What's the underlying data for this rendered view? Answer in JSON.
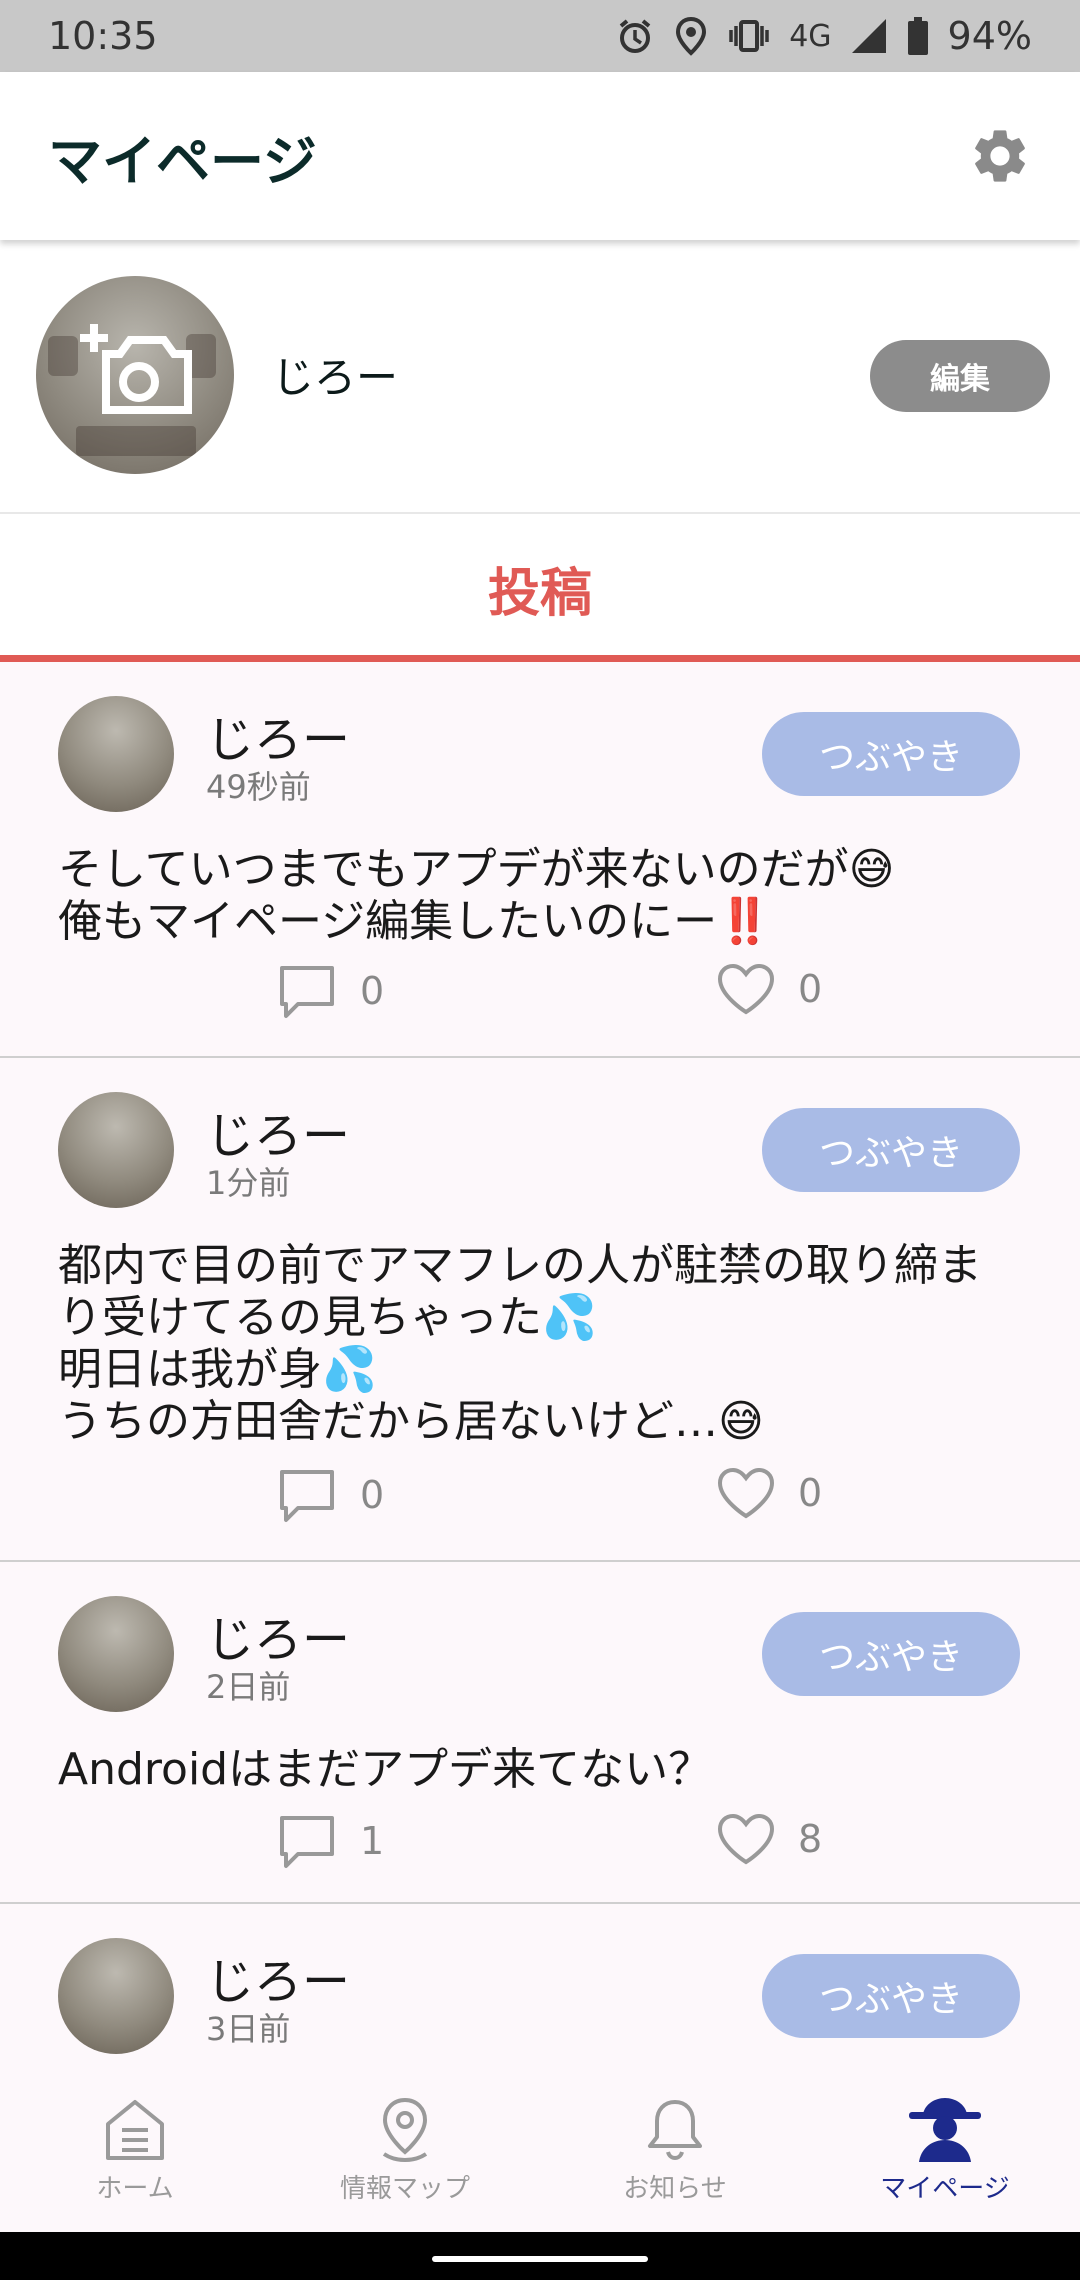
{
  "status_bar": {
    "time": "10:35",
    "network": "4G",
    "battery": "94%"
  },
  "app_bar": {
    "title": "マイページ"
  },
  "profile": {
    "name": "じろー",
    "edit_label": "編集"
  },
  "tab": {
    "label": "投稿"
  },
  "posts": [
    {
      "user": "じろー",
      "time": "49秒前",
      "tag": "つぶやき",
      "body": "そしていつまでもアプデが来ないのだが😅\n俺もマイページ編集したいのにー‼️",
      "comments": "0",
      "likes": "0"
    },
    {
      "user": "じろー",
      "time": "1分前",
      "tag": "つぶやき",
      "body": "都内で目の前でアマフレの人が駐禁の取り締まり受けてるの見ちゃった💦\n明日は我が身💦\nうちの方田舎だから居ないけど…😅",
      "comments": "0",
      "likes": "0"
    },
    {
      "user": "じろー",
      "time": "2日前",
      "tag": "つぶやき",
      "body": "Androidはまだアプデ来てない？",
      "comments": "1",
      "likes": "8"
    },
    {
      "user": "じろー",
      "time": "3日前",
      "tag": "つぶやき",
      "body": "",
      "comments": "",
      "likes": ""
    }
  ],
  "bottom_nav": [
    {
      "label": "ホーム",
      "icon": "home-icon"
    },
    {
      "label": "情報マップ",
      "icon": "map-pin-icon"
    },
    {
      "label": "お知らせ",
      "icon": "bell-icon"
    },
    {
      "label": "マイページ",
      "icon": "user-icon",
      "active": true
    }
  ],
  "colors": {
    "accent": "#e05a55",
    "tag": "#a9bbe6",
    "nav_active": "#1d2a8c"
  }
}
